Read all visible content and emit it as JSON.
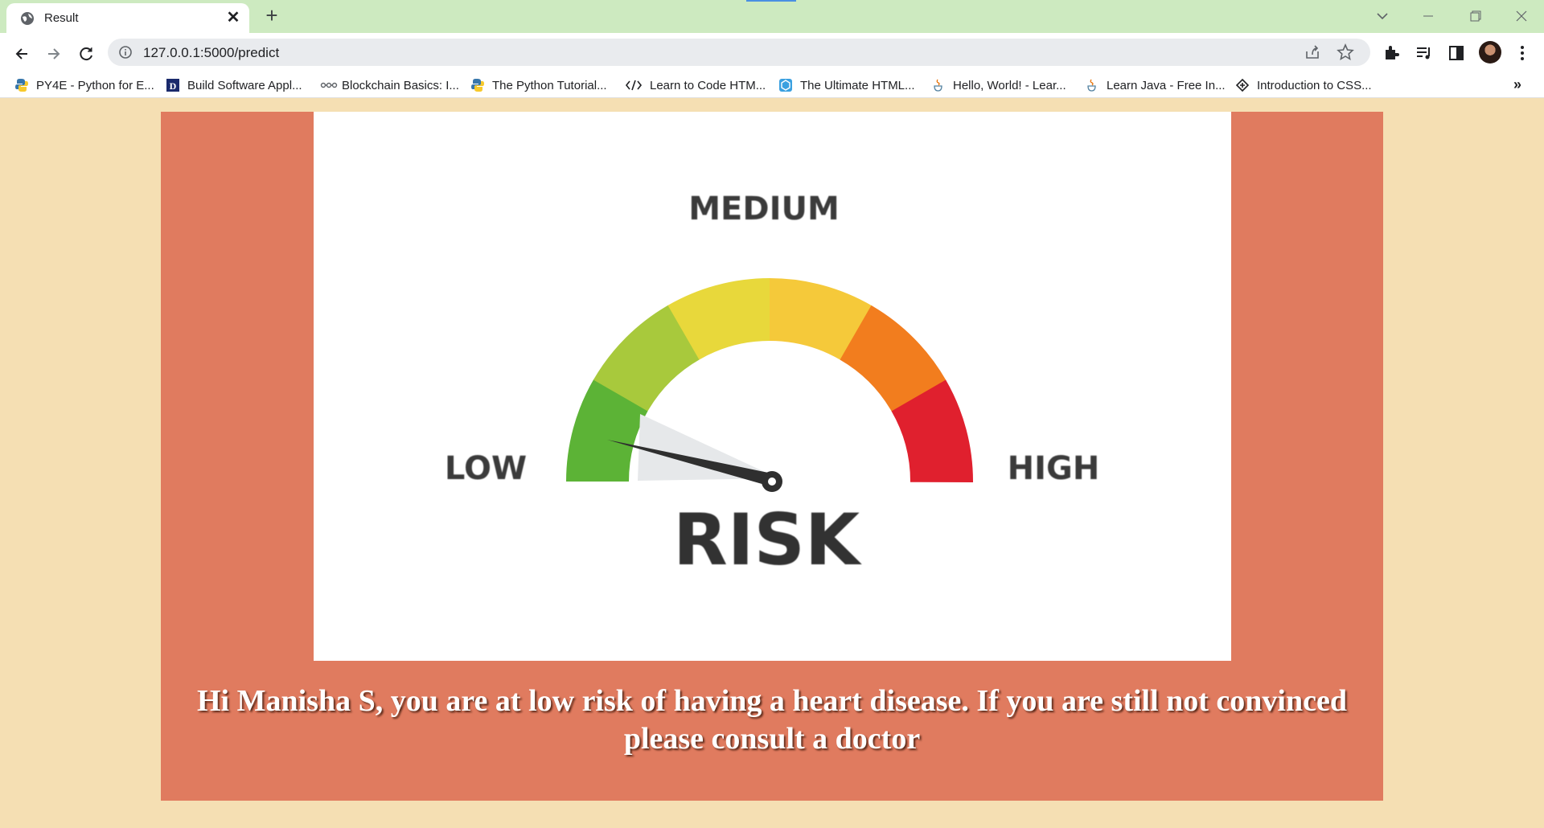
{
  "browser": {
    "tab": {
      "title": "Result",
      "favicon": "globe-icon"
    },
    "address": {
      "url": "127.0.0.1:5000/predict"
    },
    "colors": {
      "tabstrip": "#cdeac0",
      "omnibox": "#e9ebee"
    }
  },
  "bookmarks": [
    {
      "label": "PY4E - Python for E...",
      "icon": "python-logo-icon"
    },
    {
      "label": "Build Software Appl...",
      "icon": "site-logo-icon"
    },
    {
      "label": "Blockchain Basics: I...",
      "icon": "blockchain-icon"
    },
    {
      "label": "The Python Tutorial...",
      "icon": "python-logo-icon"
    },
    {
      "label": "Learn to Code HTM...",
      "icon": "code-brackets-icon"
    },
    {
      "label": "The Ultimate HTML...",
      "icon": "hexagon-logo-icon"
    },
    {
      "label": "Hello, World! - Lear...",
      "icon": "java-cup-icon"
    },
    {
      "label": "Learn Java - Free In...",
      "icon": "java-cup-icon"
    },
    {
      "label": "Introduction to CSS...",
      "icon": "codecademy-icon"
    }
  ],
  "gauge": {
    "label_low": "LOW",
    "label_medium": "MEDIUM",
    "label_high": "HIGH",
    "label_risk": "RISK",
    "level": "low",
    "colors": [
      "#5cb336",
      "#a8c93c",
      "#e8d83b",
      "#f5c93a",
      "#f27d1e",
      "#e0202e"
    ]
  },
  "result": {
    "message": "Hi Manisha S, you are at low risk of having a heart disease. If you are still not convinced please consult a doctor"
  },
  "page": {
    "background": "#f5dfb3",
    "panel": "#e07b5f"
  }
}
